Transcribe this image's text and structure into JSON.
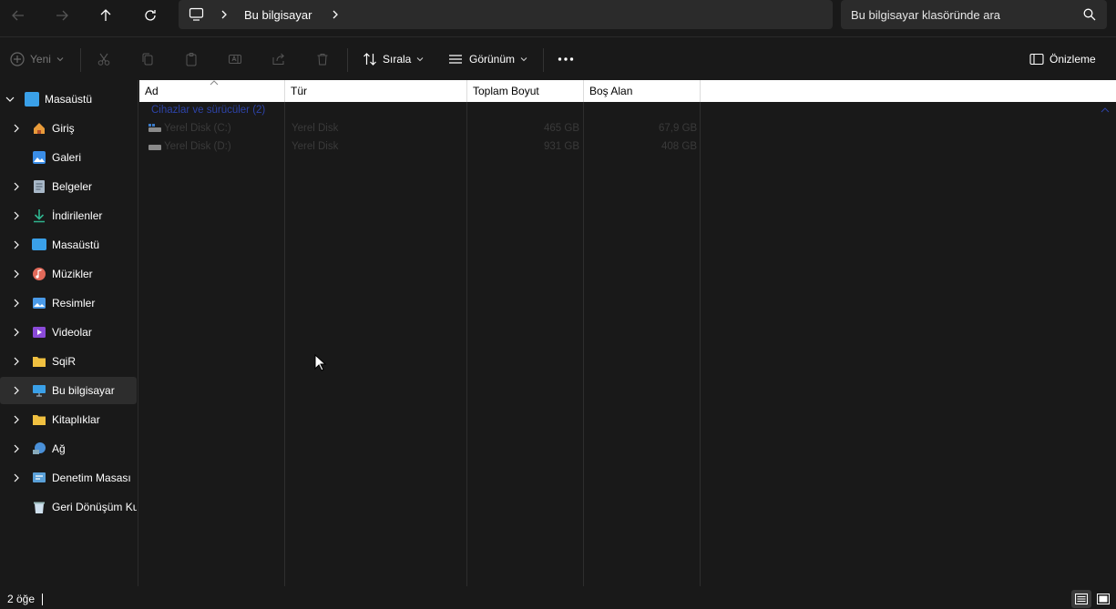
{
  "address": {
    "crumb": "Bu bilgisayar",
    "search_placeholder": "Bu bilgisayar klasöründe ara"
  },
  "toolbar": {
    "new_label": "Yeni",
    "sort_label": "Sırala",
    "view_label": "Görünüm",
    "preview_label": "Önizleme"
  },
  "sidebar": {
    "items": [
      {
        "label": "Masaüstü",
        "icon": "desktop-icon"
      },
      {
        "label": "Giriş",
        "icon": "home-icon"
      },
      {
        "label": "Galeri",
        "icon": "gallery-icon"
      },
      {
        "label": "Belgeler",
        "icon": "documents-icon"
      },
      {
        "label": "İndirilenler",
        "icon": "download-icon"
      },
      {
        "label": "Masaüstü",
        "icon": "desktop-icon"
      },
      {
        "label": "Müzikler",
        "icon": "music-icon"
      },
      {
        "label": "Resimler",
        "icon": "pictures-icon"
      },
      {
        "label": "Videolar",
        "icon": "videos-icon"
      },
      {
        "label": "SqiR",
        "icon": "folder-icon"
      },
      {
        "label": "Bu bilgisayar",
        "icon": "computer-icon"
      },
      {
        "label": "Kitaplıklar",
        "icon": "folder-icon"
      },
      {
        "label": "Ağ",
        "icon": "network-icon"
      },
      {
        "label": "Denetim Masası",
        "icon": "control-panel-icon"
      },
      {
        "label": "Geri Dönüşüm Ku",
        "icon": "recycle-bin-icon"
      }
    ]
  },
  "columns": [
    "Ad",
    "Tür",
    "Toplam Boyut",
    "Boş Alan"
  ],
  "group": "Cihazlar ve sürücüler (2)",
  "rows": [
    {
      "name": "Yerel Disk (C:)",
      "type": "Yerel Disk",
      "total": "465 GB",
      "free": "67,9 GB"
    },
    {
      "name": "Yerel Disk (D:)",
      "type": "Yerel Disk",
      "total": "931 GB",
      "free": "408 GB"
    }
  ],
  "status": {
    "count": "2 öğe"
  },
  "colors": {
    "background": "#191919",
    "selection": "#2d2d2d",
    "group_text": "#2d43a8"
  }
}
